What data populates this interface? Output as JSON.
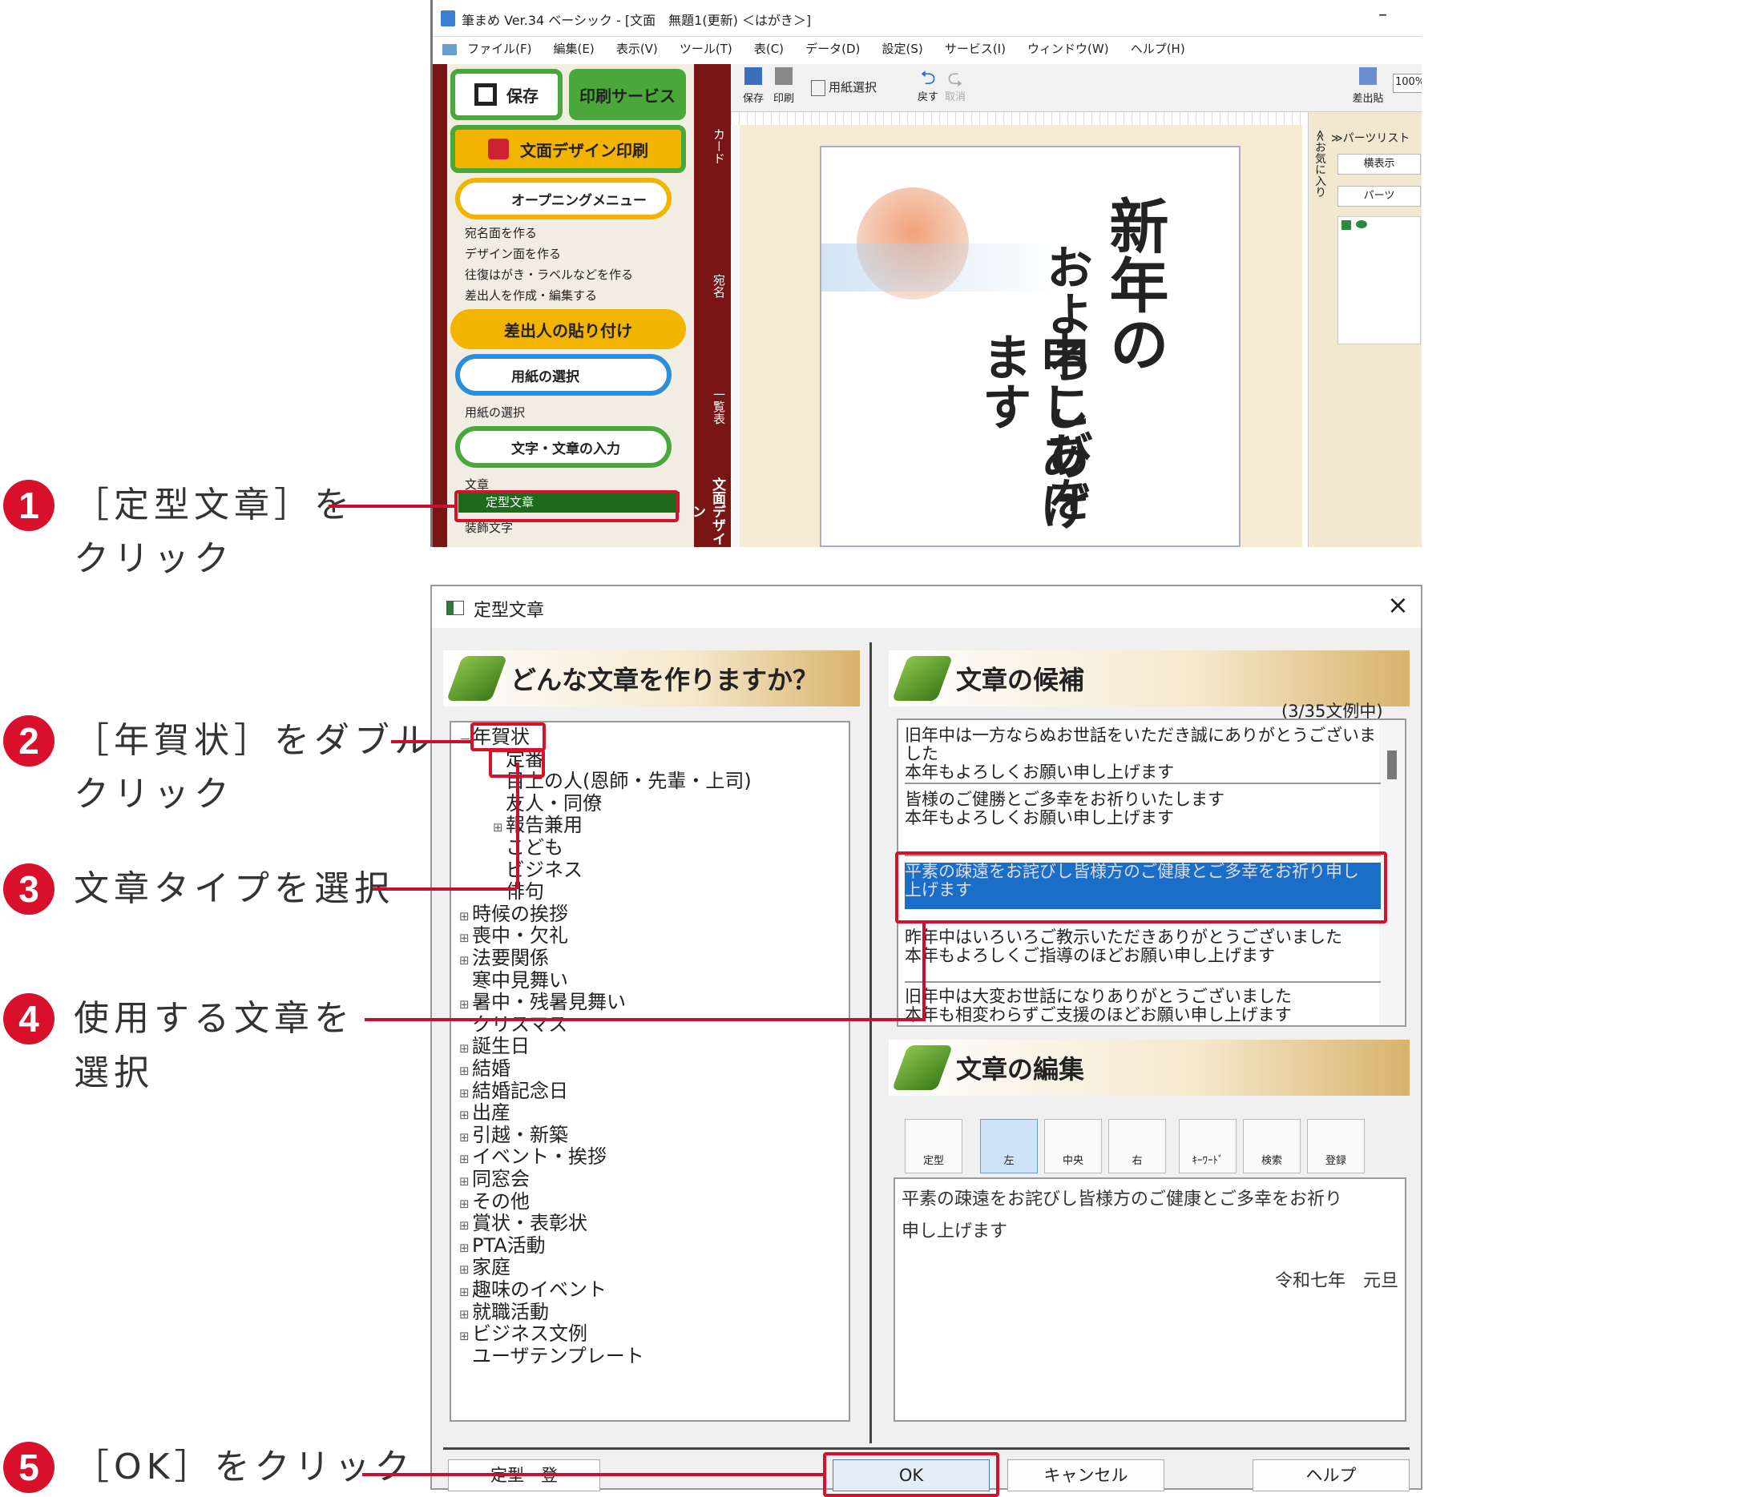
{
  "colors": {
    "accent": "#d9102c",
    "selection": "#1a6ec7",
    "sidebarGreen": "#4aa83a",
    "maroon": "#7a1515"
  },
  "app": {
    "title": "筆まめ Ver.34 ベーシック - [文面　無題1(更新) ＜はがき＞]",
    "menu": [
      "ファイル(F)",
      "編集(E)",
      "表示(V)",
      "ツール(T)",
      "表(C)",
      "データ(D)",
      "設定(S)",
      "サービス(I)",
      "ウィンドウ(W)",
      "ヘルプ(H)"
    ],
    "toolbar": {
      "save": "保存",
      "print": "印刷",
      "paper_select": "用紙選択",
      "undo": "戻す",
      "redo": "取消",
      "sender_paste": "差出貼",
      "zoom": "100%"
    },
    "sidebar": {
      "save": "保存",
      "print_service": "印刷サービス",
      "design_print": "文面デザイン印刷",
      "opening_menu": "オープニングメニュー",
      "opening_items": [
        "宛名面を作る",
        "デザイン面を作る",
        "往復はがき・ラベルなどを作る",
        "差出人を作成・編集する"
      ],
      "sender_paste": "差出人の貼り付け",
      "paper_select": "用紙の選択",
      "paper_select_item": "用紙の選択",
      "text_input": "文字・文章の入力",
      "text_item": "文章",
      "template_text": "定型文章",
      "deco_text": "装飾文字"
    },
    "side_tabs": [
      "カード",
      "宛名",
      "一覧表",
      "文面デザイン"
    ],
    "right_panel": {
      "favorites": "≪お気に入り",
      "parts_list": "≫パーツリスト",
      "list_view": "横表示",
      "parts": "パーツ"
    },
    "card_text": [
      "新年の",
      "およろこびを",
      "申しあげます"
    ]
  },
  "dialog": {
    "title": "定型文章",
    "left_banner": "どんな文章を作りますか？",
    "right_banner": "文章の候補",
    "edit_banner": "文章の編集",
    "count": "(3/35文例中)",
    "tree": [
      {
        "label": "年賀状",
        "indent": 0,
        "prefix": "－"
      },
      {
        "label": "定番",
        "indent": 1,
        "prefix": ""
      },
      {
        "label": "目上の人(恩師・先輩・上司)",
        "indent": 1,
        "prefix": ""
      },
      {
        "label": "友人・同僚",
        "indent": 1,
        "prefix": ""
      },
      {
        "label": "報告兼用",
        "indent": 1,
        "prefix": "⊞"
      },
      {
        "label": "こども",
        "indent": 1,
        "prefix": ""
      },
      {
        "label": "ビジネス",
        "indent": 1,
        "prefix": ""
      },
      {
        "label": "俳句",
        "indent": 1,
        "prefix": ""
      },
      {
        "label": "時候の挨拶",
        "indent": 0,
        "prefix": "⊞"
      },
      {
        "label": "喪中・欠礼",
        "indent": 0,
        "prefix": "⊞"
      },
      {
        "label": "法要関係",
        "indent": 0,
        "prefix": "⊞"
      },
      {
        "label": "寒中見舞い",
        "indent": 0,
        "prefix": ""
      },
      {
        "label": "暑中・残暑見舞い",
        "indent": 0,
        "prefix": "⊞"
      },
      {
        "label": "クリスマス",
        "indent": 0,
        "prefix": ""
      },
      {
        "label": "誕生日",
        "indent": 0,
        "prefix": "⊞"
      },
      {
        "label": "結婚",
        "indent": 0,
        "prefix": "⊞"
      },
      {
        "label": "結婚記念日",
        "indent": 0,
        "prefix": "⊞"
      },
      {
        "label": "出産",
        "indent": 0,
        "prefix": "⊞"
      },
      {
        "label": "引越・新築",
        "indent": 0,
        "prefix": "⊞"
      },
      {
        "label": "イベント・挨拶",
        "indent": 0,
        "prefix": "⊞"
      },
      {
        "label": "同窓会",
        "indent": 0,
        "prefix": "⊞"
      },
      {
        "label": "その他",
        "indent": 0,
        "prefix": "⊞"
      },
      {
        "label": "賞状・表彰状",
        "indent": 0,
        "prefix": "⊞"
      },
      {
        "label": "PTA活動",
        "indent": 0,
        "prefix": "⊞"
      },
      {
        "label": "家庭",
        "indent": 0,
        "prefix": "⊞"
      },
      {
        "label": "趣味のイベント",
        "indent": 0,
        "prefix": "⊞"
      },
      {
        "label": "就職活動",
        "indent": 0,
        "prefix": "⊞"
      },
      {
        "label": "ビジネス文例",
        "indent": 0,
        "prefix": "⊞"
      },
      {
        "label": "ユーザテンプレート",
        "indent": 0,
        "prefix": ""
      }
    ],
    "candidates": [
      [
        "旧年中は一方ならぬお世話をいただき誠にありがとうございま",
        "した",
        "本年もよろしくお願い申し上げます"
      ],
      [
        "皆様のご健勝とご多幸をお祈りいたします",
        "本年もよろしくお願い申し上げます"
      ],
      [
        "平素の疎遠をお詫びし皆様方のご健康とご多幸をお祈り申し",
        "上げます"
      ],
      [
        "昨年中はいろいろご教示いただきありがとうございました",
        "本年もよろしくご指導のほどお願い申し上げます"
      ],
      [
        "旧年中は大変お世話になりありがとうございました",
        "本年も相変わらずご支援のほどお願い申し上げます"
      ]
    ],
    "tools": [
      "定型",
      "左",
      "中央",
      "右",
      "ｷｰﾜｰﾄﾞ",
      "検索",
      "登録"
    ],
    "edit_text": [
      "平素の疎遠をお詫びし皆様方のご健康とご多幸をお祈り",
      "申し上げます"
    ],
    "edit_date": "令和七年　元旦",
    "buttons": {
      "register": "定型　登",
      "ok": "OK",
      "cancel": "キャンセル",
      "help": "ヘルプ"
    }
  },
  "callouts": [
    {
      "num": "1",
      "lines": [
        "［定型文章］を",
        "クリック"
      ]
    },
    {
      "num": "2",
      "lines": [
        "［年賀状］をダブル",
        "クリック"
      ]
    },
    {
      "num": "3",
      "lines": [
        "文章タイプを選択"
      ]
    },
    {
      "num": "4",
      "lines": [
        "使用する文章を",
        "選択"
      ]
    },
    {
      "num": "5",
      "lines": [
        "［OK］をクリック"
      ]
    }
  ]
}
